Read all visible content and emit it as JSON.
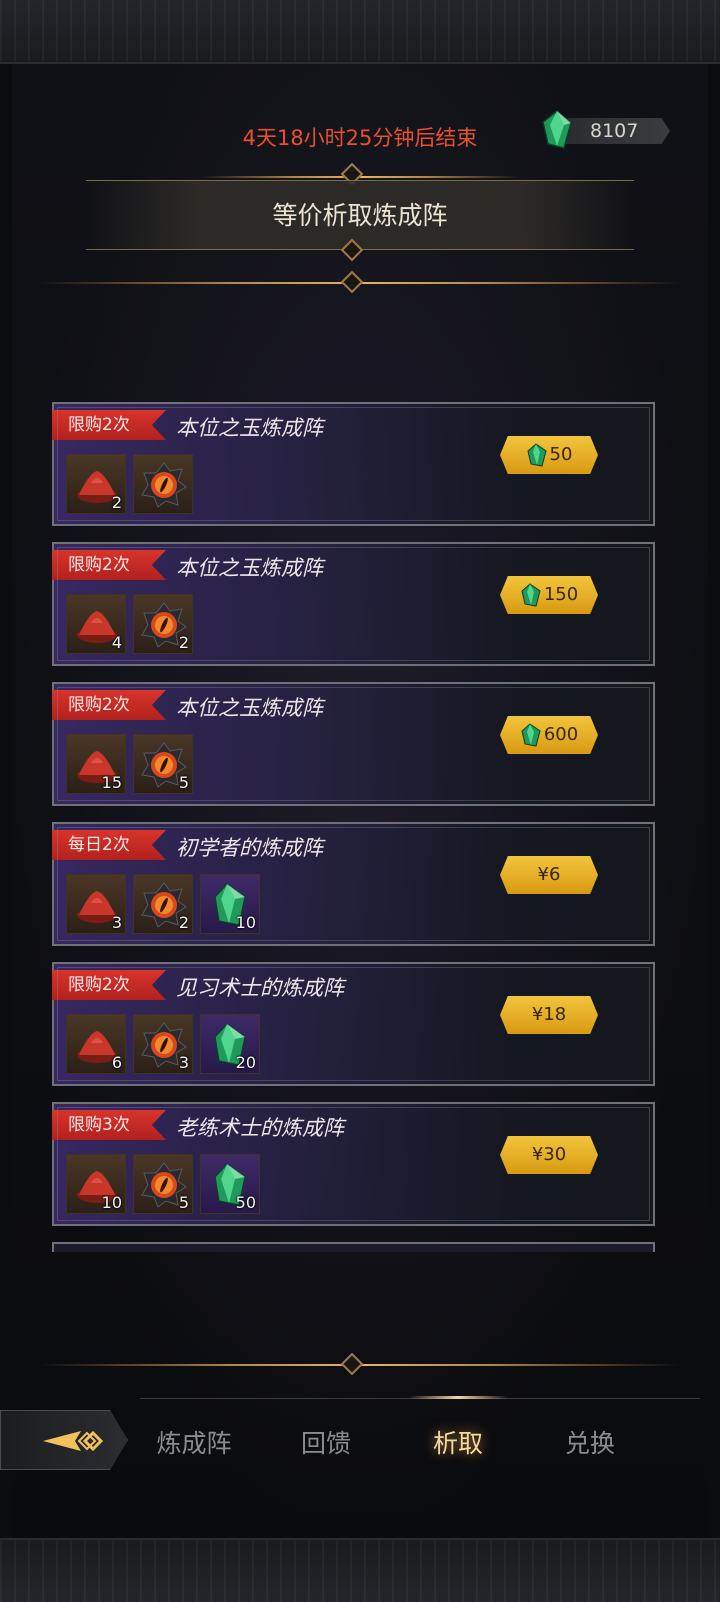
{
  "header": {
    "timer_text": "4天18小时25分钟后结束",
    "currency_amount": "8107",
    "currency_icon": "green-crystal-icon",
    "title": "等价析取炼成阵"
  },
  "colors": {
    "timer": "#e9502f",
    "badge": "#c22a22",
    "price_button": "#e6ae24",
    "active_tab": "#f4d8a8"
  },
  "offers": [
    {
      "badge": "限购2次",
      "title": "本位之玉炼成阵",
      "price": "50",
      "price_type": "crystal",
      "items": [
        {
          "icon": "red-dust-pile-icon",
          "count": "2"
        },
        {
          "icon": "fire-eye-orb-icon",
          "count": ""
        }
      ]
    },
    {
      "badge": "限购2次",
      "title": "本位之玉炼成阵",
      "price": "150",
      "price_type": "crystal",
      "items": [
        {
          "icon": "red-dust-pile-icon",
          "count": "4"
        },
        {
          "icon": "fire-eye-orb-icon",
          "count": "2"
        }
      ]
    },
    {
      "badge": "限购2次",
      "title": "本位之玉炼成阵",
      "price": "600",
      "price_type": "crystal",
      "items": [
        {
          "icon": "red-dust-pile-icon",
          "count": "15"
        },
        {
          "icon": "fire-eye-orb-icon",
          "count": "5"
        }
      ]
    },
    {
      "badge": "每日2次",
      "title": "初学者的炼成阵",
      "price": "¥6",
      "price_type": "money",
      "items": [
        {
          "icon": "red-dust-pile-icon",
          "count": "3"
        },
        {
          "icon": "fire-eye-orb-icon",
          "count": "2"
        },
        {
          "icon": "green-crystal-icon",
          "count": "10"
        }
      ]
    },
    {
      "badge": "限购2次",
      "title": "见习术士的炼成阵",
      "price": "¥18",
      "price_type": "money",
      "items": [
        {
          "icon": "red-dust-pile-icon",
          "count": "6"
        },
        {
          "icon": "fire-eye-orb-icon",
          "count": "3"
        },
        {
          "icon": "green-crystal-icon",
          "count": "20"
        }
      ]
    },
    {
      "badge": "限购3次",
      "title": "老练术士的炼成阵",
      "price": "¥30",
      "price_type": "money",
      "items": [
        {
          "icon": "red-dust-pile-icon",
          "count": "10"
        },
        {
          "icon": "fire-eye-orb-icon",
          "count": "5"
        },
        {
          "icon": "green-crystal-icon",
          "count": "50"
        }
      ]
    }
  ],
  "nav": {
    "back_icon": "back-arrow-icon",
    "tabs": [
      {
        "label": "炼成阵",
        "active": false
      },
      {
        "label": "回馈",
        "active": false
      },
      {
        "label": "析取",
        "active": true
      },
      {
        "label": "兑换",
        "active": false
      }
    ]
  }
}
